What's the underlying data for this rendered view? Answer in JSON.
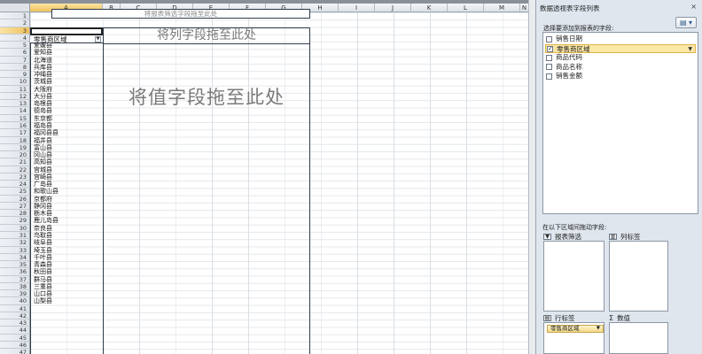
{
  "sheet": {
    "columns": [
      {
        "label": "A",
        "width": 82,
        "selected": true
      },
      {
        "label": "B",
        "width": 20
      },
      {
        "label": "C",
        "width": 41
      },
      {
        "label": "D",
        "width": 41
      },
      {
        "label": "E",
        "width": 41
      },
      {
        "label": "F",
        "width": 41
      },
      {
        "label": "G",
        "width": 41
      },
      {
        "label": "H",
        "width": 41
      },
      {
        "label": "I",
        "width": 41
      },
      {
        "label": "J",
        "width": 41
      },
      {
        "label": "K",
        "width": 41
      },
      {
        "label": "L",
        "width": 41
      },
      {
        "label": "M",
        "width": 41
      },
      {
        "label": "N",
        "width": 10
      }
    ],
    "rows": [
      "1",
      "2",
      "3",
      "4",
      "5",
      "6",
      "7",
      "8",
      "9",
      "10",
      "11",
      "12",
      "13",
      "14",
      "15",
      "16",
      "17",
      "18",
      "19",
      "20",
      "21",
      "22",
      "23",
      "24",
      "25",
      "26",
      "27",
      "28",
      "29",
      "30",
      "31",
      "32",
      "33",
      "34",
      "35",
      "36",
      "37",
      "38",
      "39",
      "40",
      "41",
      "42",
      "43",
      "44",
      "45",
      "46",
      "47"
    ],
    "selected_row": "3",
    "filter_placeholder": "将报表筛选字段拖至此处",
    "column_field_placeholder": "将列字段拖至此处",
    "value_field_placeholder": "将值字段拖至此处",
    "row_field_header": "零售商区域",
    "row_values": [
      "爱媛县",
      "爱知县",
      "北海道",
      "兵库县",
      "冲绳县",
      "茨城县",
      "大阪府",
      "大分县",
      "岛根县",
      "德岛县",
      "东京都",
      "福岛县",
      "福冈县县",
      "福井县",
      "富山县",
      "冈山县",
      "高知县",
      "宫城县",
      "宫崎县",
      "广岛县",
      "和歌山县",
      "京都府",
      "静冈县",
      "栃木县",
      "鹿儿岛县",
      "奈良县",
      "鸟取县",
      "岐阜县",
      "埼玉县",
      "千叶县",
      "青森县",
      "秋田县",
      "群马县",
      "三重县",
      "山口县",
      "山梨县"
    ]
  },
  "panel": {
    "title": "数据透视表字段列表",
    "close_icon": "×",
    "layout_button": "▤ ▾",
    "choose_label": "选择要添加到报表的字段:",
    "fields": [
      {
        "label": "销售日期",
        "checked": false
      },
      {
        "label": "零售商区域",
        "checked": true
      },
      {
        "label": "商品代码",
        "checked": false
      },
      {
        "label": "商品名称",
        "checked": false
      },
      {
        "label": "销售金额",
        "checked": false
      }
    ],
    "drag_label": "在以下区域间拖动字段:",
    "areas": {
      "filter": "报表筛选",
      "column": "列标签",
      "row": "行标签",
      "values": "数值"
    },
    "row_area_item": "零售商区域"
  }
}
